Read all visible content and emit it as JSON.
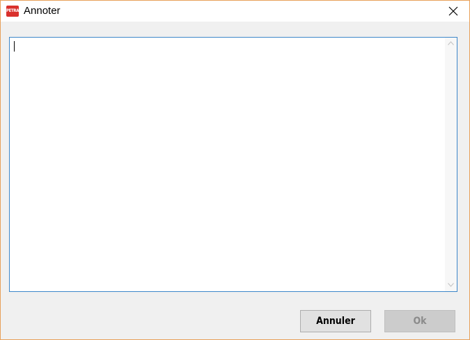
{
  "window": {
    "title": "Annoter",
    "app_icon_text": "PETRA",
    "app_icon_color": "#d9302c",
    "border_color": "#e8a05a"
  },
  "editor": {
    "value": "",
    "focus_color": "#3c86c9"
  },
  "buttons": {
    "cancel_label": "Annuler",
    "ok_label": "Ok",
    "ok_enabled": false
  }
}
